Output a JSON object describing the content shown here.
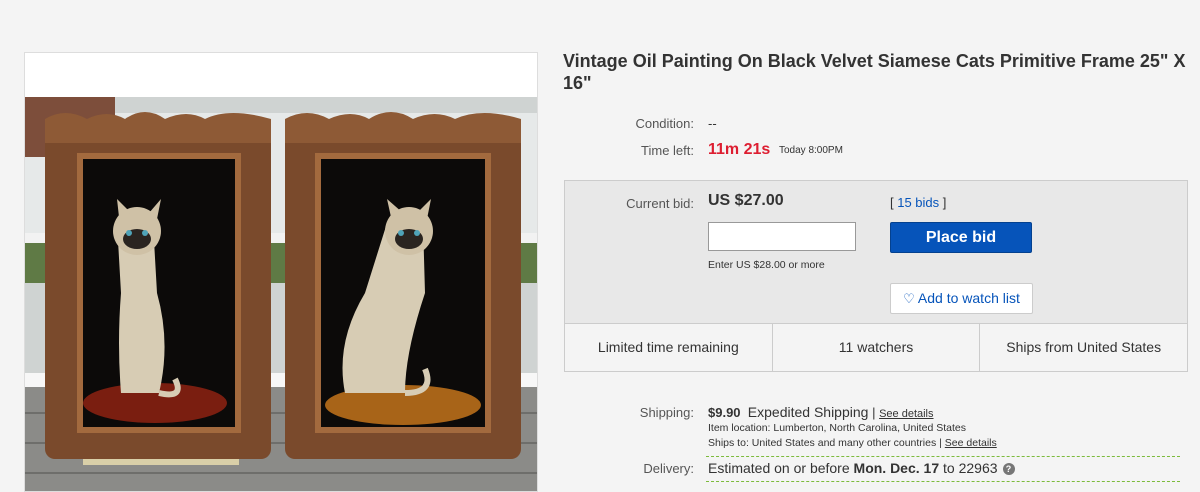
{
  "listing": {
    "title": "Vintage Oil Painting On Black Velvet Siamese Cats Primitive Frame 25\" X 16\""
  },
  "details": {
    "condition_label": "Condition:",
    "condition_value": "--",
    "time_left_label": "Time left:",
    "time_left_value": "11m 21s",
    "time_left_end": "Today 8:00PM"
  },
  "bid": {
    "current_bid_label": "Current bid:",
    "current_bid_value": "US $27.00",
    "bids_open": "[ ",
    "bids_count": "15 bids",
    "bids_close": " ]",
    "input_value": "",
    "hint": "Enter US $28.00 or more",
    "place_bid_label": "Place bid",
    "watch_label": "Add to watch list"
  },
  "info_strip": [
    "Limited time remaining",
    "11 watchers",
    "Ships from United States"
  ],
  "shipping": {
    "label": "Shipping:",
    "price": "$9.90",
    "method": "Expedited Shipping",
    "separator": "|",
    "see_details": "See details",
    "item_location": "Item location:  Lumberton, North Carolina, United States",
    "ships_to": "Ships to:  United States and many other countries",
    "ships_to_sep": "|",
    "ships_to_see_details": "See details"
  },
  "delivery": {
    "label": "Delivery:",
    "text_before": "Estimated on or before ",
    "date": "Mon. Dec. 17",
    "text_to": " to ",
    "zip": "22963",
    "help_icon": "?"
  },
  "colors": {
    "accent_blue": "#0654ba",
    "timer_red": "#dd1e31"
  }
}
